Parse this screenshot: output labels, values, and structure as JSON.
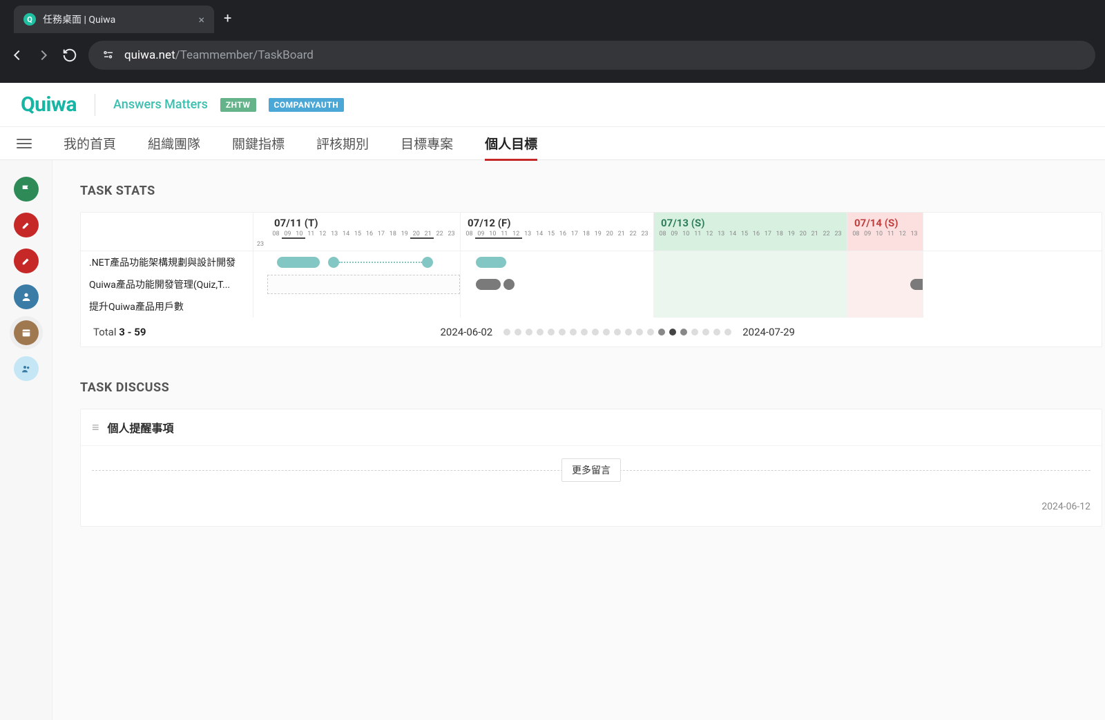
{
  "browser": {
    "tab_title": "任務桌面 | Quiwa",
    "url_host": "quiwa.net",
    "url_path": "/Teammember/TaskBoard"
  },
  "header": {
    "logo_text": "Quiwa",
    "tagline": "Answers Matters",
    "lang_badge": "ZHTW",
    "auth_badge": "COMPANYAUTH"
  },
  "main_nav": {
    "items": [
      "我的首頁",
      "組織團隊",
      "關鍵指標",
      "評核期別",
      "目標專案",
      "個人目標"
    ],
    "active_index": 5
  },
  "sections": {
    "task_stats_title": "TASK STATS",
    "task_discuss_title": "TASK DISCUSS"
  },
  "gantt": {
    "prefix_hour": "23",
    "days": [
      {
        "label": "07/11 (T)",
        "is_weekend": false,
        "hours": [
          "08",
          "09",
          "10",
          "11",
          "12",
          "13",
          "14",
          "15",
          "16",
          "17",
          "18",
          "19",
          "20",
          "21",
          "22",
          "23"
        ],
        "underline": [
          1,
          2
        ],
        "underline2": [
          12,
          13
        ]
      },
      {
        "label": "07/12 (F)",
        "is_weekend": false,
        "hours": [
          "08",
          "09",
          "10",
          "11",
          "12",
          "13",
          "14",
          "15",
          "16",
          "17",
          "18",
          "19",
          "20",
          "21",
          "22",
          "23"
        ],
        "underline": [
          1,
          2,
          3,
          4
        ]
      },
      {
        "label": "07/13 (S)",
        "is_weekend": "sat",
        "hours": [
          "08",
          "09",
          "10",
          "11",
          "12",
          "13",
          "14",
          "15",
          "16",
          "17",
          "18",
          "19",
          "20",
          "21",
          "22",
          "23"
        ]
      },
      {
        "label": "07/14 (S)",
        "is_weekend": "sun",
        "hours": [
          "08",
          "09",
          "10",
          "11",
          "12",
          "13"
        ]
      }
    ],
    "tasks": [
      ".NET產品功能架構規劃與設計開發",
      "Quiwa產品功能開發管理(Quiz,T...",
      "提升Quiwa產品用戶數"
    ],
    "footer_total_label": "Total",
    "footer_total_value": "3 - 59",
    "footer_start_date": "2024-06-02",
    "footer_end_date": "2024-07-29",
    "pagination_dots": 21,
    "pagination_active": [
      14,
      15,
      16
    ]
  },
  "discuss": {
    "panel_title": "個人提醒事項",
    "more_button": "更多留言",
    "trailing_date": "2024-06-12"
  }
}
